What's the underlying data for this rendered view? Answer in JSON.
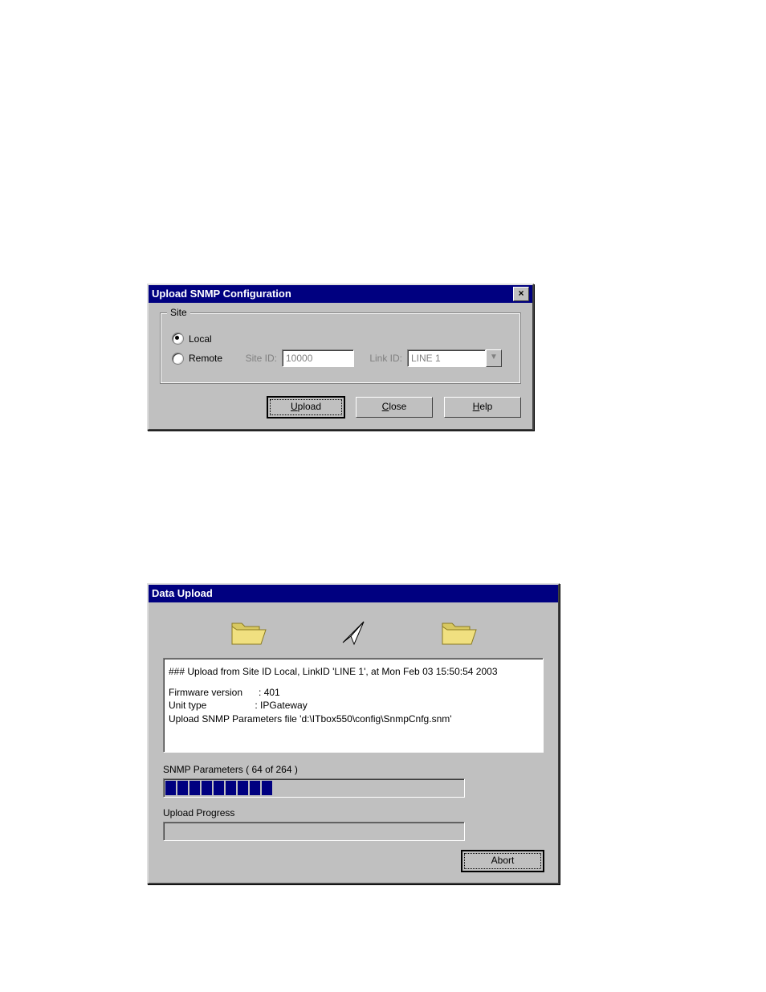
{
  "dialog1": {
    "title": "Upload SNMP Configuration",
    "group_label": "Site",
    "radios": {
      "local": "Local",
      "remote": "Remote"
    },
    "site_id_label": "Site ID:",
    "site_id_value": "10000",
    "link_id_label": "Link ID:",
    "link_id_value": "LINE 1",
    "buttons": {
      "upload": "Upload",
      "close": "Close",
      "help": "Help"
    }
  },
  "dialog2": {
    "title": "Data Upload",
    "log_line1": "### Upload from Site ID Local, LinkID 'LINE 1', at Mon Feb 03 15:50:54 2003",
    "log_line2": "Firmware version      : 401",
    "log_line3": "Unit type                  : IPGateway",
    "log_line4": "Upload SNMP Parameters file 'd:\\ITbox550\\config\\SnmpCnfg.snm'",
    "snmp_label": "SNMP Parameters ( 64 of 264 )",
    "upload_label": "Upload Progress",
    "abort": "Abort"
  }
}
